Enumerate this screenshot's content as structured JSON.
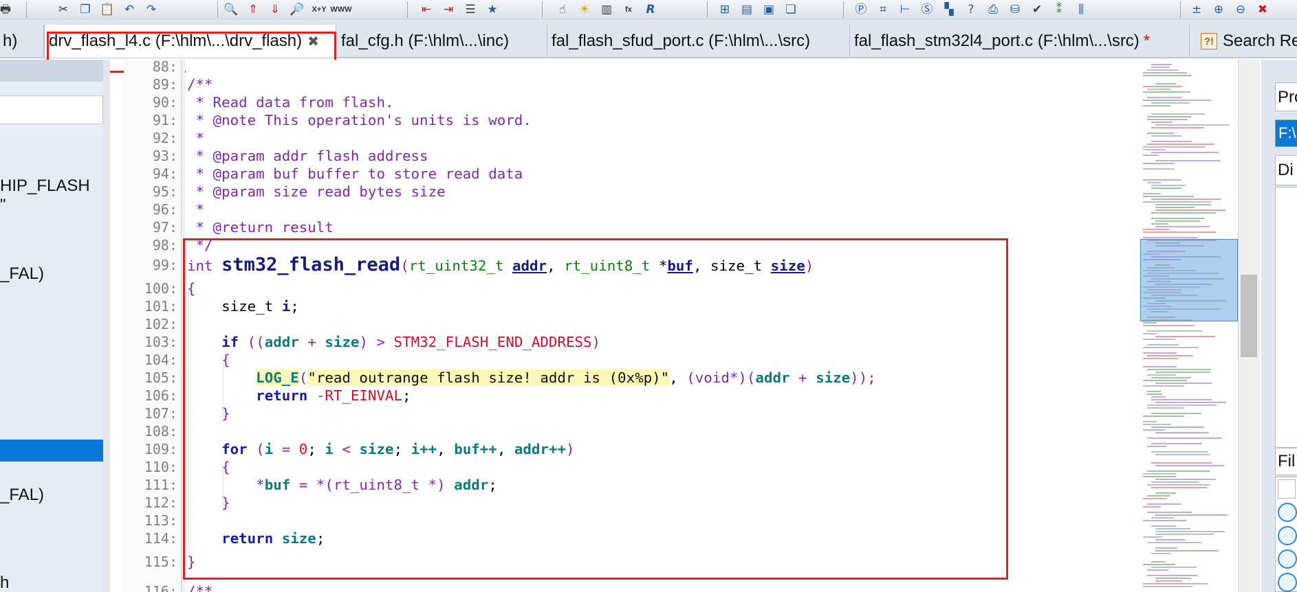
{
  "toolbar": {
    "icons": [
      "print-icon",
      "cut-icon",
      "copy-icon",
      "paste-icon",
      "undo-icon",
      "redo-icon",
      "find-icon",
      "find-prev-icon",
      "find-next-icon",
      "find-in-files-icon",
      "replace-icon",
      "www-icon",
      "jump-back-icon",
      "jump-forward-icon",
      "list-icon",
      "bookmark-icon",
      "hand-icon",
      "lightbulb-icon",
      "books-icon",
      "fx-icon",
      "r-icon",
      "table-icon",
      "window-icon",
      "windows-icon",
      "tiles-icon",
      "p-circle-icon",
      "crop-icon",
      "tree-icon",
      "s-icon",
      "puzzle-icon",
      "help-icon",
      "print2-icon",
      "drive-icon",
      "check-icon",
      "rules-icon",
      "columns-icon",
      "plus-minus-icon",
      "add-list-icon",
      "remove-list-icon",
      "close-icon"
    ],
    "labels": {
      "xy": "X+Y",
      "www": "WWW",
      "fx": "fx"
    }
  },
  "tabs": [
    {
      "label": "h)",
      "active": false
    },
    {
      "label": "drv_flash_l4.c (F:\\hlm\\...\\drv_flash)",
      "active": true,
      "close": "✖"
    },
    {
      "label": "fal_cfg.h (F:\\hlm\\...\\inc)",
      "active": false
    },
    {
      "label": "fal_flash_sfud_port.c (F:\\hlm\\...\\src)",
      "active": false
    },
    {
      "label": "fal_flash_stm32l4_port.c (F:\\hlm\\...\\src)",
      "active": false,
      "modified": "*"
    },
    {
      "label": "Search Re",
      "active": false,
      "icon": "?!"
    }
  ],
  "left_panel": {
    "items": [
      "HIP_FLASH",
      "\"",
      "_FAL)",
      "_FAL)",
      "h"
    ]
  },
  "editor": {
    "line_numbers": [
      "88:",
      "89:",
      "90:",
      "91:",
      "92:",
      "93:",
      "94:",
      "95:",
      "96:",
      "97:",
      "98:",
      "99:",
      "100:",
      "101:",
      "102:",
      "103:",
      "104:",
      "105:",
      "106:",
      "107:",
      "108:",
      "109:",
      "110:",
      "111:",
      "112:",
      "113:",
      "114:",
      "115:",
      "116:"
    ],
    "comment": {
      "l89": "/**",
      "l90": " * Read data from flash.",
      "l91": " * @note This operation's units is word.",
      "l92": " *",
      "l93": " * @param addr flash address",
      "l94": " * @param buf buffer to store read data",
      "l95": " * @param size read bytes size",
      "l96": " *",
      "l97": " * @return result",
      "l98": " */",
      "l116": "/**"
    },
    "l99": {
      "ret_type": "int",
      "fn_name": "stm32_flash_read",
      "open": "(",
      "t1": "rt_uint32_t",
      "p1": "addr",
      "comma1": ", ",
      "t2": "rt_uint8_t",
      "star": " *",
      "p2": "buf",
      "comma2": ", ",
      "t3": "size_t",
      "p3": "size",
      "close": ")"
    },
    "l100": "{",
    "l101": {
      "type": "size_t",
      "var": "i",
      "semi": ";"
    },
    "l103": {
      "kw": "if",
      "open": " ((",
      "a": "addr",
      "plus": " + ",
      "b": "size",
      "mid": ") > ",
      "macro": "STM32_FLASH_END_ADDRESS",
      "close": ")"
    },
    "l104": "{",
    "l105": {
      "fn": "LOG_E",
      "open": "(",
      "str": "\"read outrange flash size! addr is (0x%p)\"",
      "comma": ", ",
      "cast": "(void*)",
      "pa": "(",
      "a": "addr",
      "plus": " + ",
      "b": "size",
      "end": "));"
    },
    "l106": {
      "kw": "return",
      "neg": " -",
      "macro": "RT_EINVAL",
      "semi": ";"
    },
    "l107": "}",
    "l109": {
      "kw": "for",
      "open": " (",
      "i1": "i",
      "eq": " = ",
      "zero": "0",
      "s1": "; ",
      "i2": "i",
      "lt": " < ",
      "sz": "size",
      "s2": "; ",
      "i3": "i++",
      "c1": ", ",
      "bp": "buf++",
      "c2": ", ",
      "ap": "addr++",
      "close": ")"
    },
    "l110": "{",
    "l111": {
      "star": "*",
      "buf": "buf",
      "eq": " = ",
      "cast": "*(rt_uint8_t *) ",
      "addr": "addr",
      "semi": ";"
    },
    "l112": "}",
    "l114": {
      "kw": "return",
      "sp": " ",
      "var": "size",
      "semi": ";"
    },
    "l115": "}"
  },
  "right_panel": {
    "label1": "Pro",
    "field": "F:\\",
    "label2": "Di",
    "label3": "Fil"
  },
  "colors": {
    "highlight_box": "#e12020",
    "selection": "#0a78d7",
    "comment": "#7d2ba0",
    "keyword": "#1a1aa0",
    "macro": "#c8102e"
  }
}
